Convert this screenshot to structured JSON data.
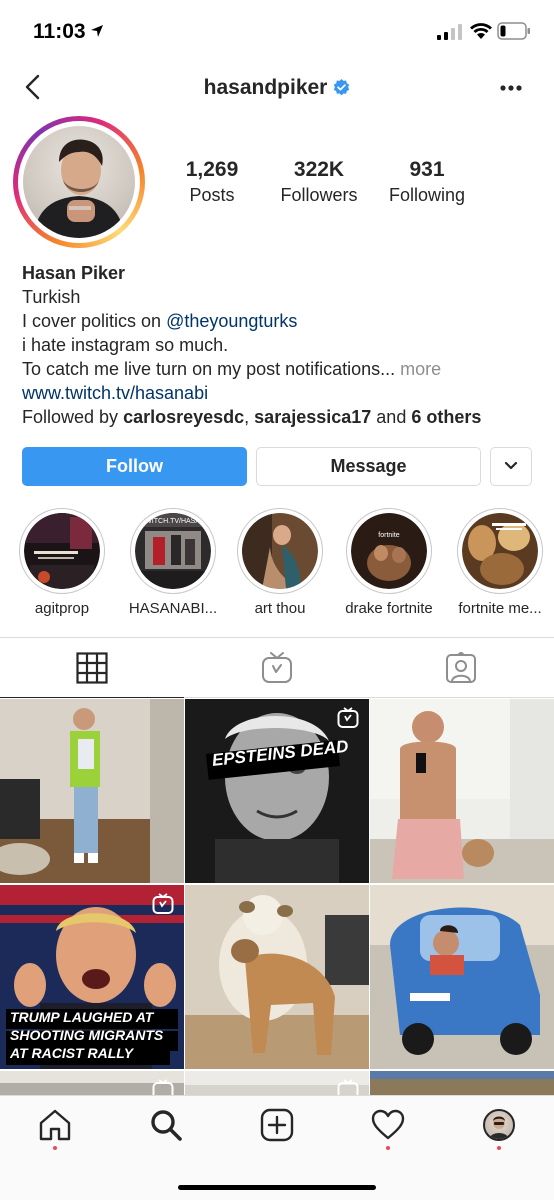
{
  "status_bar": {
    "time": "11:03"
  },
  "header": {
    "username": "hasandpiker",
    "verified": true
  },
  "profile": {
    "stats": [
      {
        "value": "1,269",
        "label": "Posts"
      },
      {
        "value": "322K",
        "label": "Followers"
      },
      {
        "value": "931",
        "label": "Following"
      }
    ],
    "bio": {
      "name": "Hasan Piker",
      "line1": "Turkish",
      "line2_prefix": "I cover politics on ",
      "line2_mention": "@theyoungturks",
      "line3": "i hate instagram so much.",
      "line4": "To catch me live turn on my post notifications...",
      "more": " more",
      "link": "www.twitch.tv/hasanabi",
      "followed_by_prefix": "Followed by ",
      "followed_user1": "carlosreyesdc",
      "followed_sep": ", ",
      "followed_user2": "sarajessica17",
      "followed_and": " and ",
      "followed_others": "6 others"
    }
  },
  "actions": {
    "follow": "Follow",
    "message": "Message"
  },
  "highlights": [
    {
      "label": "agitprop"
    },
    {
      "label": "HASANABI..."
    },
    {
      "label": "art thou"
    },
    {
      "label": "drake fortnite"
    },
    {
      "label": "fortnite me..."
    }
  ],
  "highlight_texts": {
    "hl2_banner": "TWITCH.TV/HASAN",
    "hl4_text": "fortnite"
  },
  "posts": {
    "post2_caption": "EPSTEINS DEAD",
    "post4_caption_line1": "TRUMP LAUGHED AT",
    "post4_caption_line2": "SHOOTING MIGRANTS",
    "post4_caption_line3": "AT RACIST RALLY"
  },
  "icons": {
    "tabs": [
      "grid-icon",
      "igtv-icon",
      "tagged-icon"
    ],
    "bottom_nav": [
      "home-icon",
      "search-icon",
      "add-icon",
      "heart-icon",
      "profile-icon"
    ]
  },
  "colors": {
    "accent": "#3897f0",
    "link": "#003569",
    "muted": "#8e8e8e",
    "notification_dot": "#ed4956"
  }
}
